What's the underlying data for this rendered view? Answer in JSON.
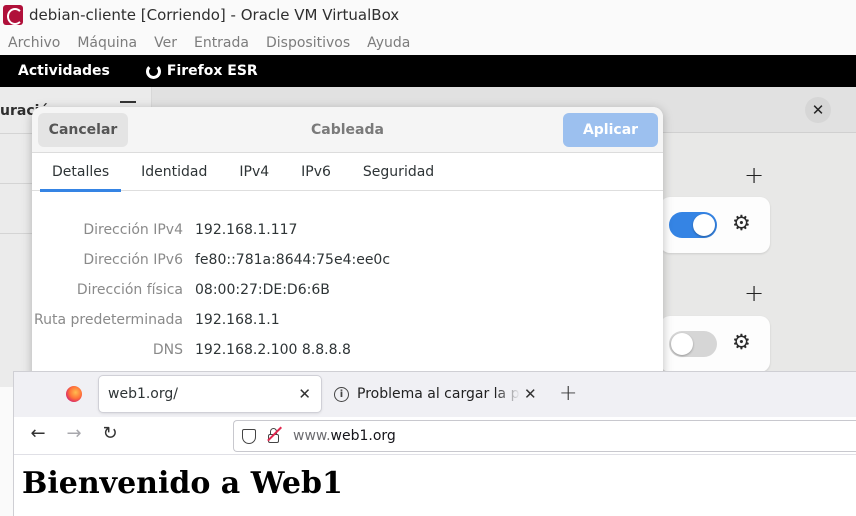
{
  "vbox": {
    "title": "debian-cliente [Corriendo] - Oracle VM VirtualBox",
    "menu": [
      "Archivo",
      "Máquina",
      "Ver",
      "Entrada",
      "Dispositivos",
      "Ayuda"
    ]
  },
  "gnome": {
    "activities": "Actividades",
    "app_name": "Firefox ESR"
  },
  "settings": {
    "sidebar_title_partial": "uració",
    "close_glyph": "✕",
    "plus_glyph": "+",
    "gear_glyph": "⚙",
    "connections": [
      {
        "toggle": "on"
      },
      {
        "toggle": "off"
      }
    ]
  },
  "dialog": {
    "cancel_label": "Cancelar",
    "title": "Cableada",
    "apply_label": "Aplicar",
    "tabs": [
      "Detalles",
      "Identidad",
      "IPv4",
      "IPv6",
      "Seguridad"
    ],
    "active_tab": "Detalles",
    "details": [
      {
        "label": "Dirección IPv4",
        "value": "192.168.1.117"
      },
      {
        "label": "Dirección IPv6",
        "value": "fe80::781a:8644:75e4:ee0c"
      },
      {
        "label": "Dirección física",
        "value": "08:00:27:DE:D6:6B"
      },
      {
        "label": "Ruta predeterminada",
        "value": "192.168.1.1"
      },
      {
        "label": "DNS",
        "value": "192.168.2.100 8.8.8.8"
      }
    ]
  },
  "firefox": {
    "tabs": [
      {
        "title": "web1.org/",
        "close": "✕"
      },
      {
        "title": "Problema al cargar la página",
        "close": "✕"
      }
    ],
    "new_tab_glyph": "+",
    "nav": {
      "back": "←",
      "forward": "→",
      "reload": "↻"
    },
    "url": {
      "prefix": "www.",
      "domain": "web1.org"
    },
    "page_heading": "Bienvenido a Web1"
  }
}
